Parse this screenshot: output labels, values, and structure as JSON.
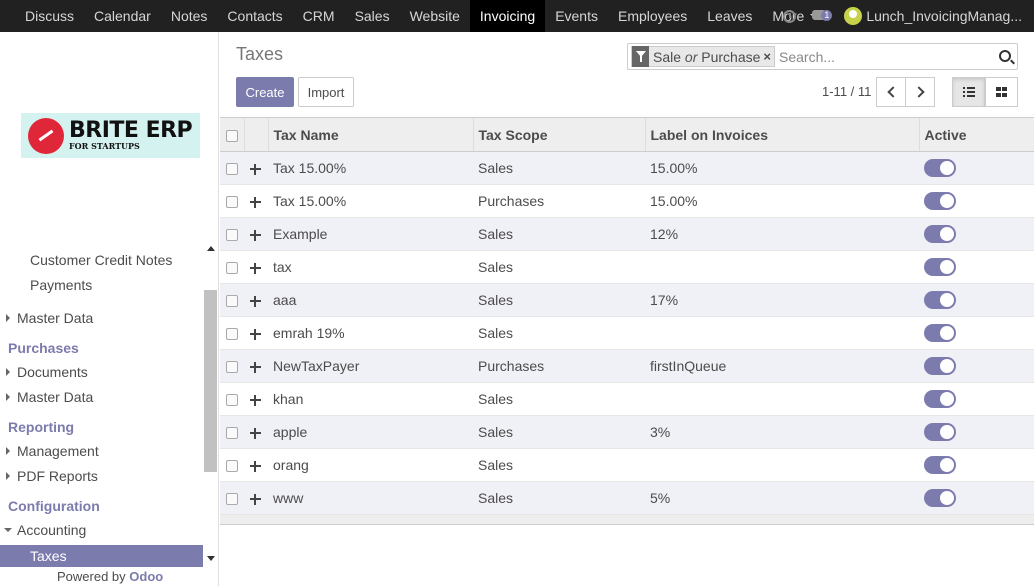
{
  "nav": {
    "items": [
      {
        "label": "Discuss",
        "active": false
      },
      {
        "label": "Calendar",
        "active": false
      },
      {
        "label": "Notes",
        "active": false
      },
      {
        "label": "Contacts",
        "active": false
      },
      {
        "label": "CRM",
        "active": false
      },
      {
        "label": "Sales",
        "active": false
      },
      {
        "label": "Website",
        "active": false
      },
      {
        "label": "Invoicing",
        "active": true
      },
      {
        "label": "Events",
        "active": false
      },
      {
        "label": "Employees",
        "active": false
      },
      {
        "label": "Leaves",
        "active": false
      }
    ],
    "more_label": "More",
    "chat_badge": "1",
    "user_name": "Lunch_InvoicingManag..."
  },
  "sidebar": {
    "logo": {
      "title": "BRITE ERP",
      "subtitle": "FOR STARTUPS"
    },
    "menu": {
      "customer_credit_notes": "Customer Credit Notes",
      "payments": "Payments",
      "master_data_1": "Master Data",
      "purchases": "Purchases",
      "documents": "Documents",
      "master_data_2": "Master Data",
      "reporting": "Reporting",
      "management": "Management",
      "pdf_reports": "PDF Reports",
      "configuration": "Configuration",
      "accounting": "Accounting",
      "taxes": "Taxes"
    },
    "powered_by": "Powered by",
    "brand": "Odoo"
  },
  "control_panel": {
    "title": "Taxes",
    "facet": {
      "value_1": "Sale",
      "or": "or",
      "value_2": "Purchase",
      "remove": "×"
    },
    "search_placeholder": "Search...",
    "create_label": "Create",
    "import_label": "Import",
    "pager": "1-11 / 11"
  },
  "table": {
    "columns": [
      "Tax Name",
      "Tax Scope",
      "Label on Invoices",
      "Active"
    ],
    "rows": [
      {
        "name": "Tax 15.00%",
        "scope": "Sales",
        "label": "15.00%",
        "active": true
      },
      {
        "name": "Tax 15.00%",
        "scope": "Purchases",
        "label": "15.00%",
        "active": true
      },
      {
        "name": "Example",
        "scope": "Sales",
        "label": "12%",
        "active": true
      },
      {
        "name": "tax",
        "scope": "Sales",
        "label": "",
        "active": true
      },
      {
        "name": "aaa",
        "scope": "Sales",
        "label": "17%",
        "active": true
      },
      {
        "name": "emrah 19%",
        "scope": "Sales",
        "label": "",
        "active": true
      },
      {
        "name": "NewTaxPayer",
        "scope": "Purchases",
        "label": "firstInQueue",
        "active": true
      },
      {
        "name": "khan",
        "scope": "Sales",
        "label": "",
        "active": true
      },
      {
        "name": "apple",
        "scope": "Sales",
        "label": "3%",
        "active": true
      },
      {
        "name": "orang",
        "scope": "Sales",
        "label": "",
        "active": true
      },
      {
        "name": "www",
        "scope": "Sales",
        "label": "5%",
        "active": true
      }
    ]
  },
  "colors": {
    "accent": "#7c7bad",
    "navbar": "#212121"
  }
}
